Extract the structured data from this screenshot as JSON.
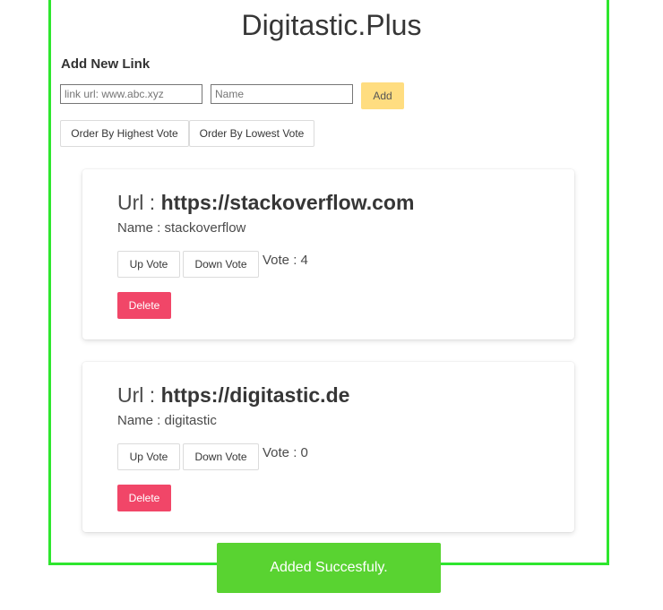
{
  "app": {
    "title": "Digitastic.Plus"
  },
  "add_form": {
    "heading": "Add New Link",
    "url_placeholder": "link url: www.abc.xyz",
    "name_placeholder": "Name",
    "add_label": "Add"
  },
  "sort": {
    "highest_label": "Order By Highest Vote",
    "lowest_label": "Order By Lowest Vote"
  },
  "links": [
    {
      "url_prefix": "Url : ",
      "url": "https://stackoverflow.com",
      "name_line": "Name : stackoverflow",
      "up_label": "Up Vote",
      "down_label": "Down Vote",
      "vote_line": "Vote : 4",
      "delete_label": "Delete"
    },
    {
      "url_prefix": "Url : ",
      "url": "https://digitastic.de",
      "name_line": "Name : digitastic",
      "up_label": "Up Vote",
      "down_label": "Down Vote",
      "vote_line": "Vote : 0",
      "delete_label": "Delete"
    }
  ],
  "toast": {
    "message": "Added Succesfuly."
  },
  "colors": {
    "frame_border": "#2ee62e",
    "add_button": "#ffdd80",
    "delete_button": "#f14668",
    "toast": "#59d331"
  }
}
